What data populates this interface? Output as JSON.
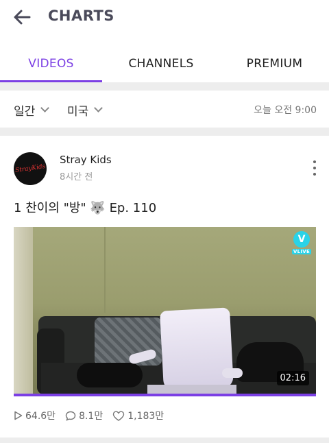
{
  "appbar": {
    "title": "CHARTS"
  },
  "tabs": [
    {
      "label": "VIDEOS",
      "active": true
    },
    {
      "label": "CHANNELS",
      "active": false
    },
    {
      "label": "PREMIUM",
      "active": false
    }
  ],
  "filters": {
    "period": "일간",
    "country": "미국",
    "updated": "오늘 오전 9:00"
  },
  "video": {
    "rank": "1",
    "title": "찬이의 \"방\" 🐺 Ep. 110",
    "channel": "Stray Kids",
    "channel_logo_text": "StrayKids",
    "posted": "8시간 전",
    "duration": "02:16",
    "badge_text": "VLIVE",
    "badge_glyph": "V",
    "progress_fraction": 1.0,
    "stats": {
      "views": "64.6만",
      "comments": "8.1만",
      "likes": "1,183만"
    }
  },
  "colors": {
    "accent": "#7b3fe4",
    "vlive": "#2ad3e8"
  },
  "icons": [
    "back-arrow-icon",
    "chevron-down-icon",
    "more-vert-icon",
    "play-icon",
    "comment-icon",
    "heart-icon"
  ]
}
